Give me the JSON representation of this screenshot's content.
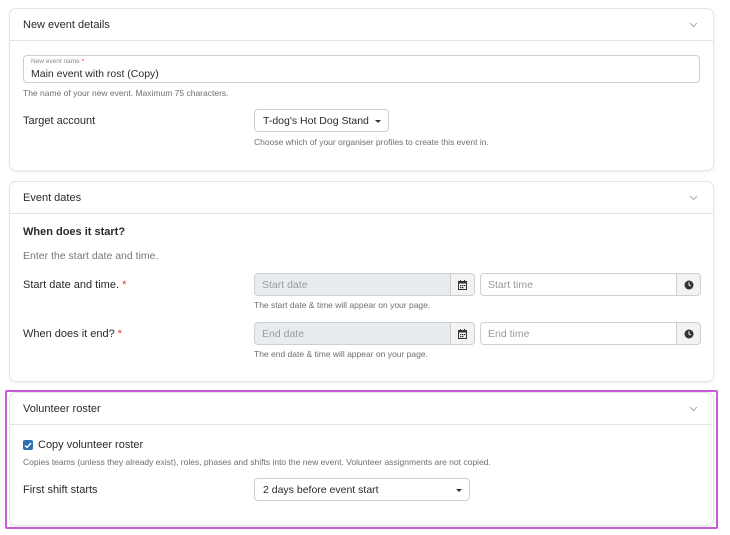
{
  "new_event": {
    "header": "New event details",
    "name_label": "New event name",
    "name_required_mark": "*",
    "name_value": "Main event with rost (Copy)",
    "name_help": "The name of your new event. Maximum 75 characters.",
    "target_label": "Target account",
    "target_value": "T-dog's Hot Dog Stand L",
    "target_help": "Choose which of your organiser profiles to create this event in."
  },
  "event_dates": {
    "header": "Event dates",
    "start_heading": "When does it start?",
    "start_intro": "Enter the start date and time.",
    "start_label": "Start date and time.",
    "required_mark": "*",
    "start_date_placeholder": "Start date",
    "start_time_placeholder": "Start time",
    "start_help": "The start date & time will appear on your page.",
    "end_label": "When does it end?",
    "end_date_placeholder": "End date",
    "end_time_placeholder": "End time",
    "end_help": "The end date & time will appear on your page."
  },
  "roster": {
    "header": "Volunteer roster",
    "copy_label": "Copy volunteer roster",
    "copy_checked": true,
    "copy_help": "Copies teams (unless they already exist), roles, phases and shifts into the new event. Volunteer assignments are not copied.",
    "first_shift_label": "First shift starts",
    "first_shift_value": "2 days before event start"
  },
  "colors": {
    "accent": "#2d6fb3",
    "highlight": "#c85bd6",
    "required": "#d93636"
  }
}
